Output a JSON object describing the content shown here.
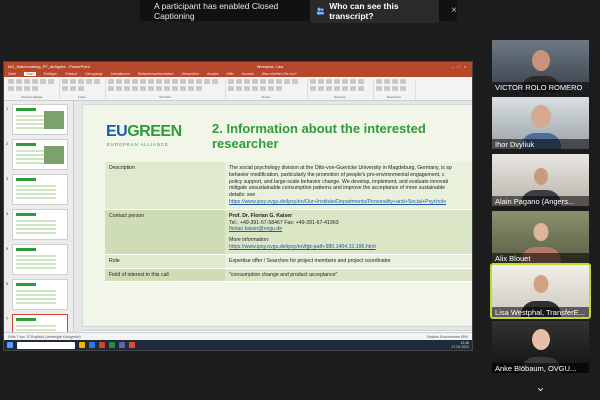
{
  "caption_banner": {
    "message": "A participant has enabled Closed Captioning",
    "button": "Who can see this transcript?",
    "close": "×"
  },
  "ppt": {
    "title": "Nr1_Matchmaking_RT_ab0gabe - PowerPoint",
    "user": "Westphal, Lisa",
    "menu": [
      "Datei",
      "Start",
      "Einfügen",
      "Entwurf",
      "Übergänge",
      "Animationen",
      "Bildschirmpräsentation",
      "Überprüfen",
      "Ansicht",
      "Hilfe",
      "Acrobat",
      "Was möchten Sie tun?"
    ],
    "active_menu": "Start",
    "ribbon_groups": [
      "Zwischenablage",
      "Folien",
      "Schriftart",
      "Absatz",
      "Zeichnen",
      "Bearbeiten"
    ],
    "notes_placeholder": "Klicken Sie, um Notizen hinzuzufügen",
    "status_left": "Folie 7 von 12   Englisch (Vereinigte Königreich)",
    "status_right": "Notizen   Kommentare   85%",
    "clock_time": "13:48",
    "clock_date": "27.04.2021"
  },
  "thumbnails": [
    {
      "num": "1"
    },
    {
      "num": "2"
    },
    {
      "num": "3"
    },
    {
      "num": "4"
    },
    {
      "num": "5"
    },
    {
      "num": "6"
    },
    {
      "num": "7"
    }
  ],
  "slide": {
    "logo_eu": "EU",
    "logo_green": "GREEN",
    "logo_sub": "EUROPEAN ALLIANCE",
    "title": "2. Information about the interested researcher",
    "rows": [
      {
        "key": "Description",
        "lines": [
          "The social psychology division at the Otto-von-Guericke University in Magdeburg, Germany, is sp",
          "behavior modification, particularly the promotion of people's pro-environmental engagement, c",
          "policy support, and large-scale behavior change. We develop, implement, and evaluate innovati",
          "mitigate unsustainable consumption patterns and improve the acceptance of more sustainable",
          "details: see"
        ],
        "link": "https://www.ipsy.ovgu.de/ipsy/en/Our+Institute/Departments/Personality+and+Social+Psycholo"
      },
      {
        "key": "Contact person",
        "name": "Prof. Dr. Florian G. Kaiser",
        "tel": "Tel.: +49-391-67-58467 Fax: +49-391-67-41963",
        "email": "florian.kaiser@ovgu.de",
        "more": "More information:",
        "link": "https://www.ipsy.ovgu.de/ipsy/en/fgk-path-980,1404,31,196.html"
      },
      {
        "key": "Role",
        "value": "Expertise offer / Searches for project members and project coordinator"
      },
      {
        "key": "Field of interest in this call",
        "value": "\"consumption change and product acceptance\""
      }
    ]
  },
  "participants": [
    {
      "name": "VICTOR ROLO ROMERO"
    },
    {
      "name": "Ihor Dvyliuk"
    },
    {
      "name": "Alain Pagano (Angers..."
    },
    {
      "name": "Alix Blouet"
    },
    {
      "name": "Lisa Westphal, TransferE..."
    },
    {
      "name": "Anke Blöbaum, OVGU..."
    }
  ],
  "more_participants": "⌄",
  "colors": {
    "accent_green": "#2f9b3a",
    "eu_blue": "#1c5aa8",
    "ppt_red": "#b7472a",
    "active_speaker": "#c4d830"
  }
}
